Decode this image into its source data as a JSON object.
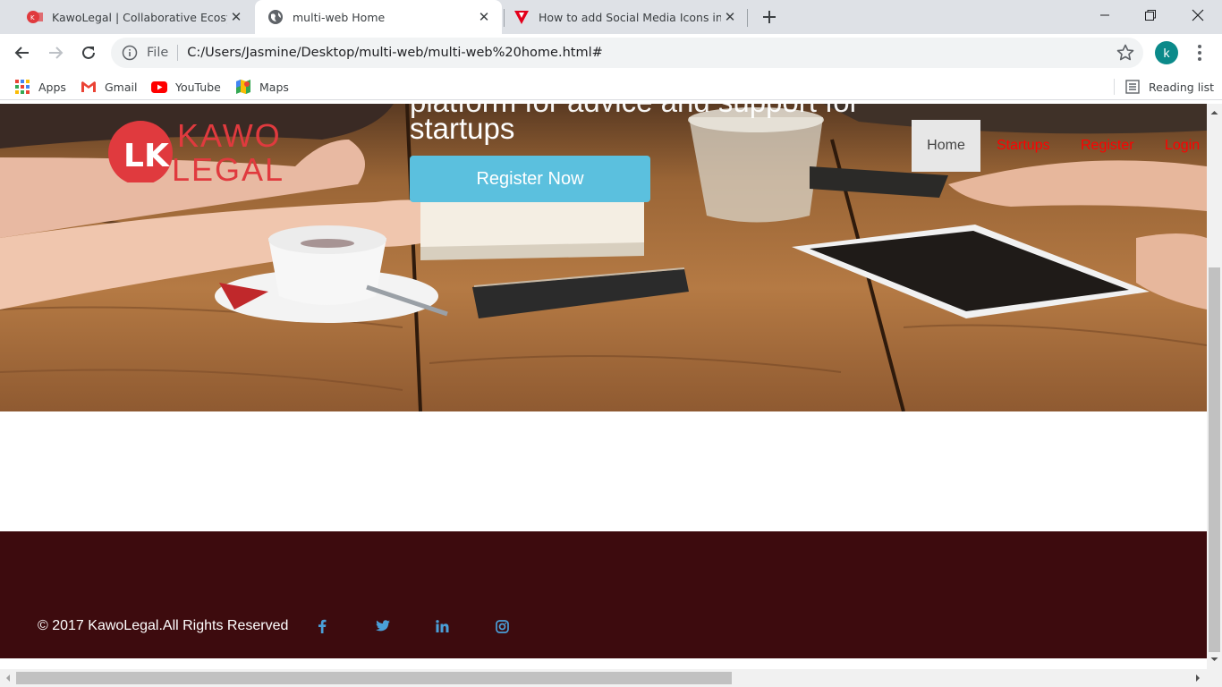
{
  "browser": {
    "tabs": [
      {
        "title": "KawoLegal | Collaborative Ecosystem",
        "active": false
      },
      {
        "title": "multi-web Home",
        "active": true
      },
      {
        "title": "How to add Social Media Icons in HTML",
        "active": false
      }
    ],
    "address": {
      "scheme_label": "File",
      "url": "C:/Users/Jasmine/Desktop/multi-web/multi-web%20home.html#"
    },
    "profile_initial": "k",
    "bookmarks": [
      {
        "label": "Apps",
        "icon": "apps-grid-icon"
      },
      {
        "label": "Gmail",
        "icon": "gmail-icon"
      },
      {
        "label": "YouTube",
        "icon": "youtube-icon"
      },
      {
        "label": "Maps",
        "icon": "maps-icon"
      }
    ],
    "reading_list": "Reading list"
  },
  "page": {
    "logo": {
      "line1": "KAWO",
      "line2": "LEGAL",
      "mark": "LK"
    },
    "hero": {
      "heading_cut": "platform for advice and support for",
      "heading_line2": "startups",
      "cta": "Register Now"
    },
    "nav": {
      "home": "Home",
      "startups": "Startups",
      "register": "Register",
      "login": "Login"
    },
    "footer": {
      "copyright": "© 2017 KawoLegal.All Rights Reserved",
      "social": [
        "facebook-icon",
        "twitter-icon",
        "linkedin-icon",
        "instagram-icon"
      ]
    }
  },
  "colors": {
    "accent_button": "#5bc0de",
    "nav_link": "#ff0000",
    "footer_bg": "#3d0b0e",
    "social_icon": "#4a9fd8",
    "logo_red": "#e03a3e"
  }
}
